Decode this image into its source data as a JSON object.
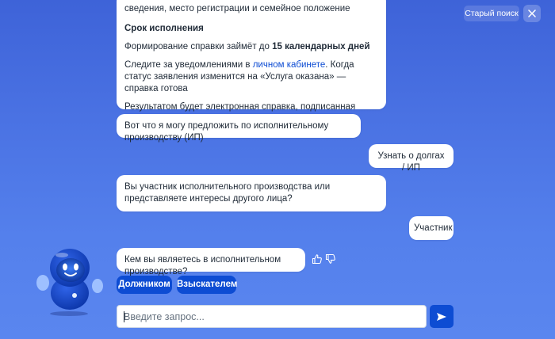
{
  "header": {
    "old_search_label": "Старый поиск",
    "close_icon": "close-icon"
  },
  "messages": {
    "bot_info": {
      "line_top": "сведения, место регистрации и семейное положение",
      "heading": "Срок исполнения",
      "term_prefix": "Формирование справки займёт до ",
      "term_bold": "15 календарных дней",
      "notify_prefix": "Следите за уведомлениями в ",
      "notify_link": "личном кабинете",
      "notify_suffix": ". Когда статус заявления изменится на «Услуга оказана» — справка готова",
      "result": "Результатом будет электронная справка, подписанная электронной подписью"
    },
    "bot_ip": "Вот что я могу предложить по исполнительному производству (ИП)",
    "user_debts": "Узнать о долгах / ИП",
    "bot_role": "Вы участник исполнительного производства или представляете интересы другого лица?",
    "user_member": "Участник",
    "bot_who": "Кем вы являетесь в исполнительном производстве?"
  },
  "feedback": {
    "like_icon": "thumbs-up-icon",
    "dislike_icon": "thumbs-down-icon"
  },
  "quick_replies": {
    "option_1": "Должником",
    "option_2": "Взыскателем"
  },
  "composer": {
    "placeholder": "Введите запрос...",
    "value": "",
    "send_icon": "send-icon"
  },
  "assistant": {
    "avatar_icon": "robot-assistant-icon"
  },
  "colors": {
    "background": "#4a72e3",
    "accent": "#0d4cd3",
    "bubble": "#ffffff",
    "link": "#0d4cd3"
  }
}
